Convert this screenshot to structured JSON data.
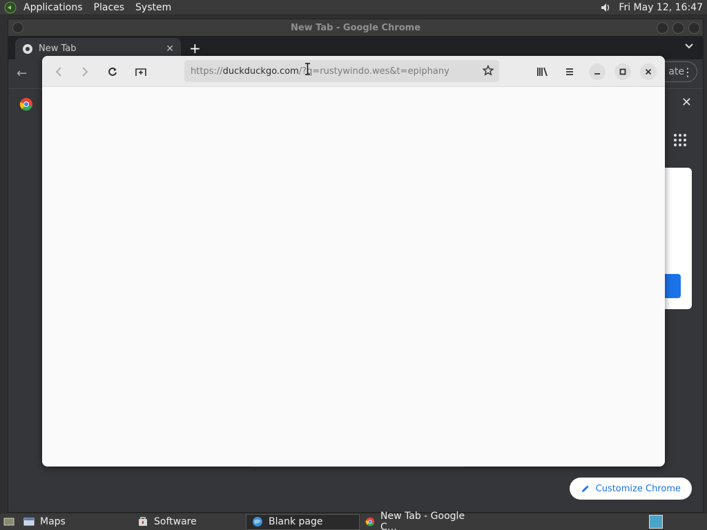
{
  "top_panel": {
    "menus": [
      "Applications",
      "Places",
      "System"
    ],
    "clock": "Fri May 12, 16:47"
  },
  "chrome": {
    "window_title": "New Tab - Google Chrome",
    "tab_title": "New Tab",
    "update_partial": "ate",
    "customize_label": "Customize Chrome",
    "accent": "#1a73e8"
  },
  "epiphany": {
    "url_scheme": "https://",
    "url_host": "duckduckgo.com",
    "url_rest": "/?q=rustywindo.wes&t=epiphany"
  },
  "taskbar": {
    "items": [
      {
        "label": "Maps",
        "icon": "window-icon"
      },
      {
        "label": "Software",
        "icon": "software-icon"
      },
      {
        "label": "Blank page",
        "icon": "epiphany-icon"
      },
      {
        "label": "New Tab - Google C…",
        "icon": "chrome-icon"
      }
    ]
  }
}
